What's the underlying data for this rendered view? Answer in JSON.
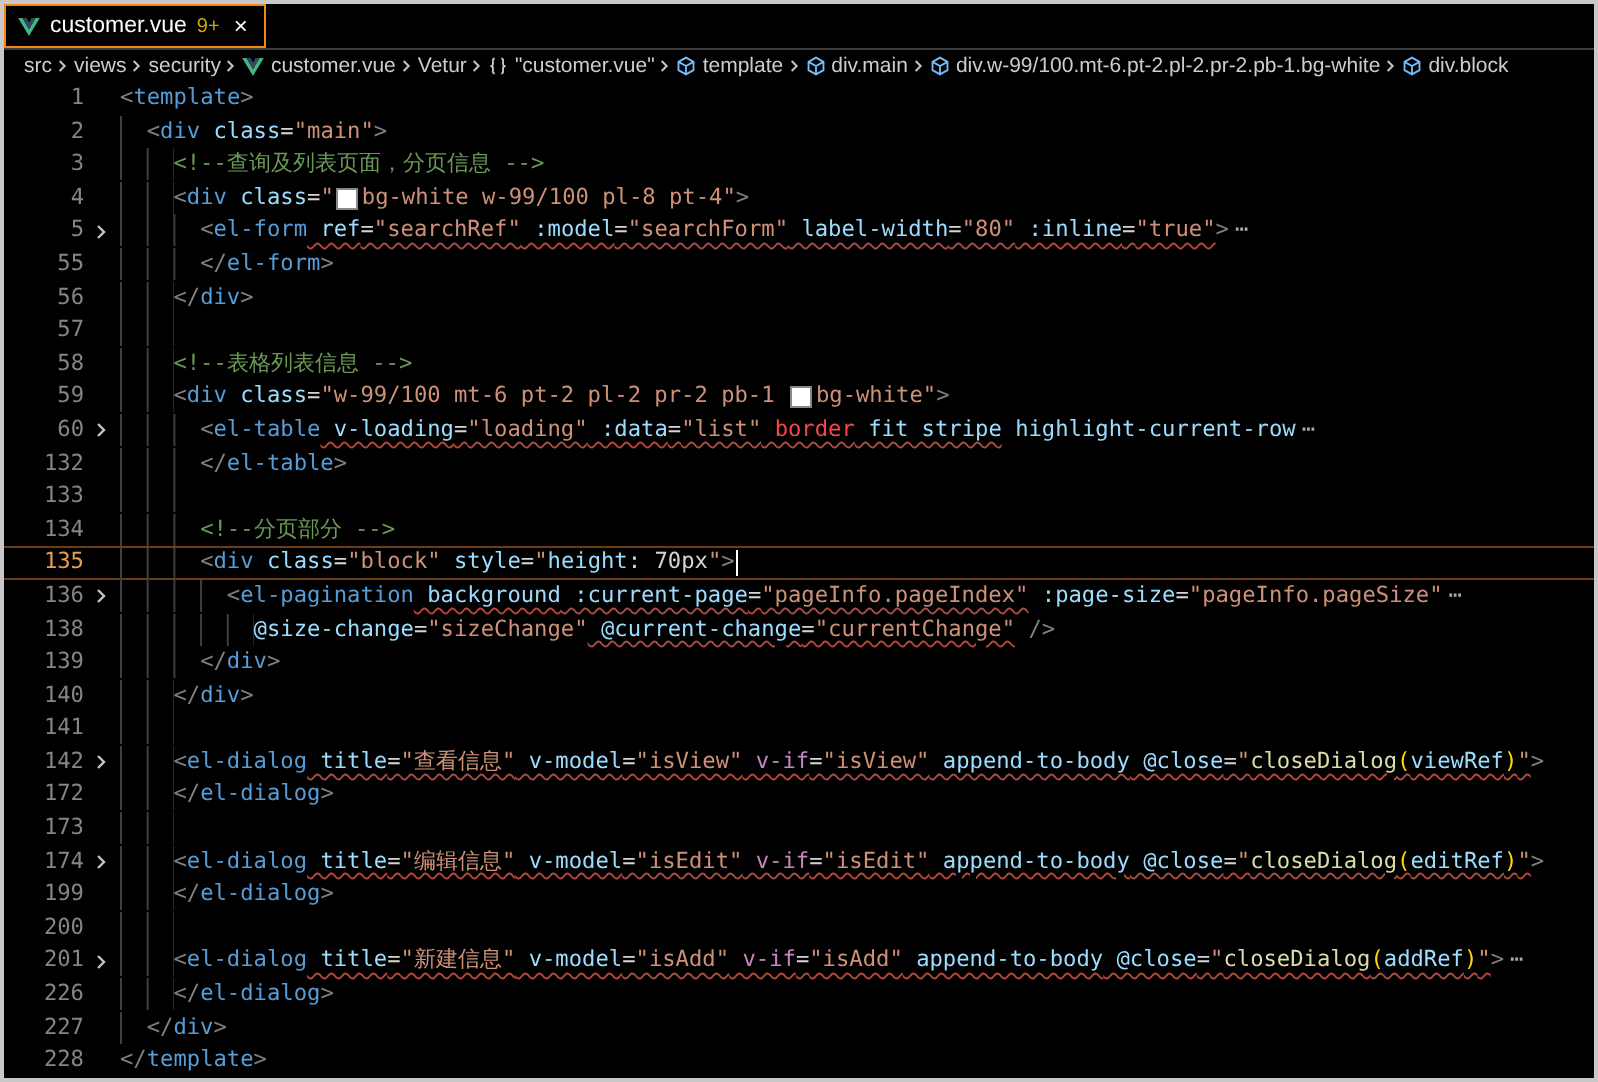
{
  "tabs": [
    {
      "label": "customer.vue",
      "problems": "9+",
      "close": "×",
      "selected": true
    }
  ],
  "breadcrumbs": [
    {
      "kind": "folder",
      "label": "src"
    },
    {
      "kind": "folder",
      "label": "views"
    },
    {
      "kind": "folder",
      "label": "security"
    },
    {
      "kind": "file",
      "label": "customer.vue"
    },
    {
      "kind": "folder",
      "label": "Vetur"
    },
    {
      "kind": "module",
      "label": "\"customer.vue\""
    },
    {
      "kind": "element",
      "label": "template"
    },
    {
      "kind": "element",
      "label": "div.main"
    },
    {
      "kind": "element",
      "label": "div.w-99/100.mt-6.pt-2.pl-2.pr-2.pb-1.bg-white"
    },
    {
      "kind": "element",
      "label": "div.block"
    }
  ],
  "lines": [
    {
      "number": "1",
      "folded": false,
      "current": false,
      "segments": [
        {
          "squiggle": false,
          "tokens": [
            {
              "kind": "punct",
              "text": "<"
            },
            {
              "kind": "tag",
              "text": "template"
            },
            {
              "kind": "punct",
              "text": ">"
            }
          ]
        }
      ],
      "children": [
        {
          "number": "2",
          "folded": false,
          "current": false,
          "segments": [
            {
              "squiggle": false,
              "tokens": [
                {
                  "kind": "punct",
                  "text": "<"
                },
                {
                  "kind": "tag",
                  "text": "div"
                },
                {
                  "kind": "attr",
                  "text": " class"
                },
                {
                  "kind": "text",
                  "text": "="
                },
                {
                  "kind": "string",
                  "text": "\"main\""
                },
                {
                  "kind": "punct",
                  "text": ">"
                }
              ]
            }
          ],
          "children": [
            {
              "number": "3",
              "folded": false,
              "current": false,
              "segments": [
                {
                  "squiggle": false,
                  "tokens": [
                    {
                      "kind": "comment",
                      "text": "<!--查询及列表页面，分页信息 -->"
                    }
                  ]
                }
              ]
            },
            {
              "number": "4",
              "folded": false,
              "current": false,
              "segments": [
                {
                  "squiggle": false,
                  "tokens": [
                    {
                      "kind": "punct",
                      "text": "<"
                    },
                    {
                      "kind": "tag",
                      "text": "div"
                    },
                    {
                      "kind": "attr",
                      "text": " class"
                    },
                    {
                      "kind": "text",
                      "text": "="
                    },
                    {
                      "kind": "string",
                      "text": "\""
                    },
                    {
                      "kind": "swatch",
                      "color": "#ffffff"
                    },
                    {
                      "kind": "string",
                      "text": "bg-white w-99/100 pl-8 pt-4\""
                    },
                    {
                      "kind": "punct",
                      "text": ">"
                    }
                  ]
                }
              ],
              "children": [
                {
                  "number": "5",
                  "folded": true,
                  "current": false,
                  "segments": [
                    {
                      "squiggle": false,
                      "tokens": [
                        {
                          "kind": "punct",
                          "text": "<"
                        },
                        {
                          "kind": "tag",
                          "text": "el-form"
                        }
                      ]
                    },
                    {
                      "squiggle": true,
                      "tokens": [
                        {
                          "kind": "attr",
                          "text": " ref"
                        },
                        {
                          "kind": "text",
                          "text": "="
                        },
                        {
                          "kind": "string",
                          "text": "\"searchRef\""
                        },
                        {
                          "kind": "attr",
                          "text": " :model"
                        },
                        {
                          "kind": "text",
                          "text": "="
                        },
                        {
                          "kind": "string",
                          "text": "\"searchForm\""
                        },
                        {
                          "kind": "attr",
                          "text": " label-width"
                        },
                        {
                          "kind": "text",
                          "text": "="
                        },
                        {
                          "kind": "string",
                          "text": "\"80\""
                        },
                        {
                          "kind": "attr",
                          "text": " :inline"
                        },
                        {
                          "kind": "text",
                          "text": "="
                        },
                        {
                          "kind": "string",
                          "text": "\"true\""
                        }
                      ]
                    },
                    {
                      "squiggle": false,
                      "tokens": [
                        {
                          "kind": "punct",
                          "text": ">"
                        },
                        {
                          "kind": "fold",
                          "text": "⋯"
                        }
                      ]
                    }
                  ]
                },
                {
                  "number": "55",
                  "folded": false,
                  "current": false,
                  "segments": [
                    {
                      "squiggle": false,
                      "tokens": [
                        {
                          "kind": "punct",
                          "text": "</"
                        },
                        {
                          "kind": "tag",
                          "text": "el-form"
                        },
                        {
                          "kind": "punct",
                          "text": ">"
                        }
                      ]
                    }
                  ]
                }
              ]
            },
            {
              "number": "56",
              "folded": false,
              "current": false,
              "segments": [
                {
                  "squiggle": false,
                  "tokens": [
                    {
                      "kind": "punct",
                      "text": "</"
                    },
                    {
                      "kind": "tag",
                      "text": "div"
                    },
                    {
                      "kind": "punct",
                      "text": ">"
                    }
                  ]
                }
              ]
            },
            {
              "number": "57",
              "folded": false,
              "current": false
            },
            {
              "number": "58",
              "folded": false,
              "current": false,
              "segments": [
                {
                  "squiggle": false,
                  "tokens": [
                    {
                      "kind": "comment",
                      "text": "<!--表格列表信息 -->"
                    }
                  ]
                }
              ]
            },
            {
              "number": "59",
              "folded": false,
              "current": false,
              "segments": [
                {
                  "squiggle": false,
                  "tokens": [
                    {
                      "kind": "punct",
                      "text": "<"
                    },
                    {
                      "kind": "tag",
                      "text": "div"
                    },
                    {
                      "kind": "attr",
                      "text": " class"
                    },
                    {
                      "kind": "text",
                      "text": "="
                    },
                    {
                      "kind": "string",
                      "text": "\"w-99/100 mt-6 pt-2 pl-2 pr-2 pb-1 "
                    },
                    {
                      "kind": "swatch",
                      "color": "#ffffff"
                    },
                    {
                      "kind": "string",
                      "text": "bg-white\""
                    },
                    {
                      "kind": "punct",
                      "text": ">"
                    }
                  ]
                }
              ],
              "children": [
                {
                  "number": "60",
                  "folded": true,
                  "current": false,
                  "segments": [
                    {
                      "squiggle": false,
                      "tokens": [
                        {
                          "kind": "punct",
                          "text": "<"
                        },
                        {
                          "kind": "tag",
                          "text": "el-table"
                        }
                      ]
                    },
                    {
                      "squiggle": true,
                      "tokens": [
                        {
                          "kind": "attr",
                          "text": " v-loading"
                        },
                        {
                          "kind": "text",
                          "text": "="
                        },
                        {
                          "kind": "string",
                          "text": "\"loading\""
                        },
                        {
                          "kind": "attr",
                          "text": " :data"
                        },
                        {
                          "kind": "text",
                          "text": "="
                        },
                        {
                          "kind": "string",
                          "text": "\"list\""
                        },
                        {
                          "kind": "keyword",
                          "text": " border"
                        },
                        {
                          "kind": "attr",
                          "text": " fit stripe"
                        }
                      ]
                    },
                    {
                      "squiggle": false,
                      "tokens": [
                        {
                          "kind": "attr",
                          "text": " highlight-current-row"
                        },
                        {
                          "kind": "fold",
                          "text": "⋯"
                        }
                      ]
                    }
                  ]
                },
                {
                  "number": "132",
                  "folded": false,
                  "current": false,
                  "segments": [
                    {
                      "squiggle": false,
                      "tokens": [
                        {
                          "kind": "punct",
                          "text": "</"
                        },
                        {
                          "kind": "tag",
                          "text": "el-table"
                        },
                        {
                          "kind": "punct",
                          "text": ">"
                        }
                      ]
                    }
                  ]
                },
                {
                  "number": "133",
                  "folded": false,
                  "current": false
                },
                {
                  "number": "134",
                  "folded": false,
                  "current": false,
                  "segments": [
                    {
                      "squiggle": false,
                      "tokens": [
                        {
                          "kind": "comment",
                          "text": "<!--分页部分 -->"
                        }
                      ]
                    }
                  ]
                },
                {
                  "number": "135",
                  "folded": false,
                  "current": true,
                  "segments": [
                    {
                      "squiggle": false,
                      "tokens": [
                        {
                          "kind": "punct",
                          "text": "<"
                        },
                        {
                          "kind": "tag",
                          "text": "div"
                        },
                        {
                          "kind": "attr",
                          "text": " class"
                        },
                        {
                          "kind": "text",
                          "text": "="
                        },
                        {
                          "kind": "string",
                          "text": "\"block\""
                        },
                        {
                          "kind": "attr",
                          "text": " style"
                        },
                        {
                          "kind": "text",
                          "text": "="
                        },
                        {
                          "kind": "string",
                          "text": "\""
                        },
                        {
                          "kind": "attr",
                          "text": "height"
                        },
                        {
                          "kind": "text",
                          "text": ": 70px"
                        },
                        {
                          "kind": "string",
                          "text": "\""
                        },
                        {
                          "kind": "punct",
                          "text": ">"
                        }
                      ]
                    }
                  ],
                  "children": [
                    {
                      "number": "136",
                      "folded": true,
                      "current": false,
                      "segments": [
                        {
                          "squiggle": false,
                          "tokens": [
                            {
                              "kind": "punct",
                              "text": "<"
                            },
                            {
                              "kind": "tag",
                              "text": "el-pagination"
                            }
                          ]
                        },
                        {
                          "squiggle": true,
                          "tokens": [
                            {
                              "kind": "attr",
                              "text": " background"
                            },
                            {
                              "kind": "attr",
                              "text": " :current-page"
                            },
                            {
                              "kind": "text",
                              "text": "="
                            },
                            {
                              "kind": "string",
                              "text": "\"pageInfo.pageIndex\""
                            }
                          ]
                        },
                        {
                          "squiggle": false,
                          "tokens": [
                            {
                              "kind": "attr",
                              "text": " :page-size"
                            },
                            {
                              "kind": "text",
                              "text": "="
                            },
                            {
                              "kind": "string",
                              "text": "\"pageInfo.pageSize\""
                            },
                            {
                              "kind": "fold",
                              "text": "⋯"
                            }
                          ]
                        }
                      ],
                      "children": [
                        {
                          "number": "138",
                          "folded": false,
                          "current": false,
                          "segments": [
                            {
                              "squiggle": false,
                              "tokens": [
                                {
                                  "kind": "attr",
                                  "text": "@size-change"
                                },
                                {
                                  "kind": "text",
                                  "text": "="
                                },
                                {
                                  "kind": "string",
                                  "text": "\"sizeChange\""
                                }
                              ]
                            },
                            {
                              "squiggle": true,
                              "tokens": [
                                {
                                  "kind": "attr",
                                  "text": " @current-change"
                                },
                                {
                                  "kind": "text",
                                  "text": "="
                                },
                                {
                                  "kind": "string",
                                  "text": "\"currentChange\""
                                }
                              ]
                            },
                            {
                              "squiggle": false,
                              "tokens": [
                                {
                                  "kind": "punct",
                                  "text": " />"
                                }
                              ]
                            }
                          ]
                        }
                      ]
                    }
                  ]
                },
                {
                  "number": "139",
                  "folded": false,
                  "current": false,
                  "segments": [
                    {
                      "squiggle": false,
                      "tokens": [
                        {
                          "kind": "punct",
                          "text": "</"
                        },
                        {
                          "kind": "tag",
                          "text": "div"
                        },
                        {
                          "kind": "punct",
                          "text": ">"
                        }
                      ]
                    }
                  ]
                }
              ]
            },
            {
              "number": "140",
              "folded": false,
              "current": false,
              "segments": [
                {
                  "squiggle": false,
                  "tokens": [
                    {
                      "kind": "punct",
                      "text": "</"
                    },
                    {
                      "kind": "tag",
                      "text": "div"
                    },
                    {
                      "kind": "punct",
                      "text": ">"
                    }
                  ]
                }
              ]
            },
            {
              "number": "141",
              "folded": false,
              "current": false
            },
            {
              "number": "142",
              "folded": true,
              "current": false,
              "segments": [
                {
                  "squiggle": false,
                  "tokens": [
                    {
                      "kind": "punct",
                      "text": "<"
                    },
                    {
                      "kind": "tag",
                      "text": "el-dialog"
                    }
                  ]
                },
                {
                  "squiggle": true,
                  "tokens": [
                    {
                      "kind": "attr",
                      "text": " title"
                    },
                    {
                      "kind": "text",
                      "text": "="
                    },
                    {
                      "kind": "string",
                      "text": "\"查看信息\""
                    },
                    {
                      "kind": "attr",
                      "text": " v-model"
                    },
                    {
                      "kind": "text",
                      "text": "="
                    },
                    {
                      "kind": "string",
                      "text": "\"isView\""
                    },
                    {
                      "kind": "directive",
                      "text": " v-if"
                    },
                    {
                      "kind": "text",
                      "text": "="
                    },
                    {
                      "kind": "string",
                      "text": "\"isView\""
                    },
                    {
                      "kind": "attr",
                      "text": " append-to-body"
                    },
                    {
                      "kind": "attr",
                      "text": " @close"
                    },
                    {
                      "kind": "text",
                      "text": "="
                    },
                    {
                      "kind": "string",
                      "text": "\""
                    },
                    {
                      "kind": "func",
                      "text": "closeDialog"
                    },
                    {
                      "kind": "paren",
                      "text": "("
                    },
                    {
                      "kind": "attr",
                      "text": "viewRef"
                    },
                    {
                      "kind": "paren",
                      "text": ")"
                    },
                    {
                      "kind": "string",
                      "text": "\""
                    }
                  ]
                },
                {
                  "squiggle": false,
                  "tokens": [
                    {
                      "kind": "punct",
                      "text": ">"
                    }
                  ]
                }
              ]
            },
            {
              "number": "172",
              "folded": false,
              "current": false,
              "segments": [
                {
                  "squiggle": false,
                  "tokens": [
                    {
                      "kind": "punct",
                      "text": "</"
                    },
                    {
                      "kind": "tag",
                      "text": "el-dialog"
                    },
                    {
                      "kind": "punct",
                      "text": ">"
                    }
                  ]
                }
              ]
            },
            {
              "number": "173",
              "folded": false,
              "current": false
            },
            {
              "number": "174",
              "folded": true,
              "current": false,
              "segments": [
                {
                  "squiggle": false,
                  "tokens": [
                    {
                      "kind": "punct",
                      "text": "<"
                    },
                    {
                      "kind": "tag",
                      "text": "el-dialog"
                    }
                  ]
                },
                {
                  "squiggle": true,
                  "tokens": [
                    {
                      "kind": "attr",
                      "text": " title"
                    },
                    {
                      "kind": "text",
                      "text": "="
                    },
                    {
                      "kind": "string",
                      "text": "\"编辑信息\""
                    },
                    {
                      "kind": "attr",
                      "text": " v-model"
                    },
                    {
                      "kind": "text",
                      "text": "="
                    },
                    {
                      "kind": "string",
                      "text": "\"isEdit\""
                    },
                    {
                      "kind": "directive",
                      "text": " v-if"
                    },
                    {
                      "kind": "text",
                      "text": "="
                    },
                    {
                      "kind": "string",
                      "text": "\"isEdit\""
                    },
                    {
                      "kind": "attr",
                      "text": " append-to-body"
                    },
                    {
                      "kind": "attr",
                      "text": " @close"
                    },
                    {
                      "kind": "text",
                      "text": "="
                    },
                    {
                      "kind": "string",
                      "text": "\""
                    },
                    {
                      "kind": "func",
                      "text": "closeDialog"
                    },
                    {
                      "kind": "paren",
                      "text": "("
                    },
                    {
                      "kind": "attr",
                      "text": "editRef"
                    },
                    {
                      "kind": "paren",
                      "text": ")"
                    },
                    {
                      "kind": "string",
                      "text": "\""
                    }
                  ]
                },
                {
                  "squiggle": false,
                  "tokens": [
                    {
                      "kind": "punct",
                      "text": ">"
                    }
                  ]
                }
              ]
            },
            {
              "number": "199",
              "folded": false,
              "current": false,
              "segments": [
                {
                  "squiggle": false,
                  "tokens": [
                    {
                      "kind": "punct",
                      "text": "</"
                    },
                    {
                      "kind": "tag",
                      "text": "el-dialog"
                    },
                    {
                      "kind": "punct",
                      "text": ">"
                    }
                  ]
                }
              ]
            },
            {
              "number": "200",
              "folded": false,
              "current": false
            },
            {
              "number": "201",
              "folded": true,
              "current": false,
              "segments": [
                {
                  "squiggle": false,
                  "tokens": [
                    {
                      "kind": "punct",
                      "text": "<"
                    },
                    {
                      "kind": "tag",
                      "text": "el-dialog"
                    }
                  ]
                },
                {
                  "squiggle": true,
                  "tokens": [
                    {
                      "kind": "attr",
                      "text": " title"
                    },
                    {
                      "kind": "text",
                      "text": "="
                    },
                    {
                      "kind": "string",
                      "text": "\"新建信息\""
                    },
                    {
                      "kind": "attr",
                      "text": " v-model"
                    },
                    {
                      "kind": "text",
                      "text": "="
                    },
                    {
                      "kind": "string",
                      "text": "\"isAdd\""
                    },
                    {
                      "kind": "directive",
                      "text": " v-if"
                    },
                    {
                      "kind": "text",
                      "text": "="
                    },
                    {
                      "kind": "string",
                      "text": "\"isAdd\""
                    },
                    {
                      "kind": "attr",
                      "text": " append-to-body"
                    },
                    {
                      "kind": "attr",
                      "text": " @close"
                    },
                    {
                      "kind": "text",
                      "text": "="
                    },
                    {
                      "kind": "string",
                      "text": "\""
                    },
                    {
                      "kind": "func",
                      "text": "closeDialog"
                    },
                    {
                      "kind": "paren",
                      "text": "("
                    },
                    {
                      "kind": "attr",
                      "text": "addRef"
                    },
                    {
                      "kind": "paren",
                      "text": ")"
                    },
                    {
                      "kind": "string",
                      "text": "\""
                    }
                  ]
                },
                {
                  "squiggle": false,
                  "tokens": [
                    {
                      "kind": "punct",
                      "text": ">"
                    },
                    {
                      "kind": "fold",
                      "text": "⋯"
                    }
                  ]
                }
              ]
            },
            {
              "number": "226",
              "folded": false,
              "current": false,
              "segments": [
                {
                  "squiggle": false,
                  "tokens": [
                    {
                      "kind": "punct",
                      "text": "</"
                    },
                    {
                      "kind": "tag",
                      "text": "el-dialog"
                    },
                    {
                      "kind": "punct",
                      "text": ">"
                    }
                  ]
                }
              ]
            }
          ]
        },
        {
          "number": "227",
          "folded": false,
          "current": false,
          "segments": [
            {
              "squiggle": false,
              "tokens": [
                {
                  "kind": "punct",
                  "text": "</"
                },
                {
                  "kind": "tag",
                  "text": "div"
                },
                {
                  "kind": "punct",
                  "text": ">"
                }
              ]
            }
          ]
        }
      ]
    },
    {
      "number": "228",
      "folded": false,
      "current": false,
      "segments": [
        {
          "squiggle": false,
          "tokens": [
            {
              "kind": "punct",
              "text": "</"
            },
            {
              "kind": "tag",
              "text": "template"
            },
            {
              "kind": "punct",
              "text": ">"
            }
          ]
        }
      ]
    }
  ]
}
